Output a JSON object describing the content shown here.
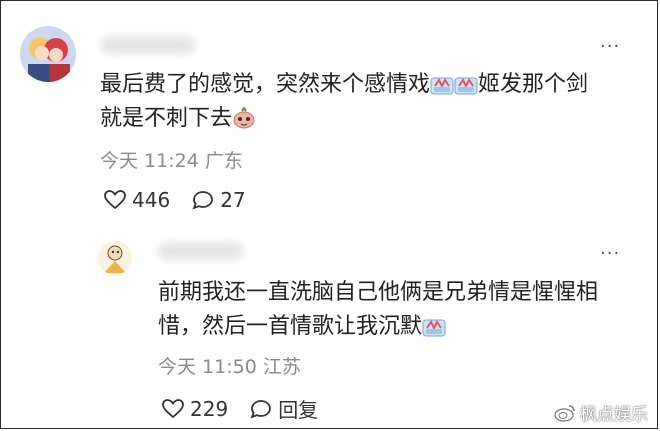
{
  "comment": {
    "text_line1": "最后费了的感觉，突然来个感情戏",
    "text_line1_tail": "姬发那个剑",
    "text_line2": "就是不刺下去",
    "time": "今天 11:24",
    "location": "广东",
    "likes": "446",
    "replies": "27"
  },
  "reply": {
    "text_line1": "前期我还一直洗脑自己他俩是兄弟情是惺惺相",
    "text_line2": "惜，然后一首情歌让我沉默",
    "time": "今天 11:50",
    "location": "江苏",
    "likes": "229",
    "reply_label": "回复"
  },
  "watermark": "枫点娱乐",
  "icons": [
    "more-icon",
    "heart-icon",
    "comment-icon",
    "emoji-icon",
    "weibo-logo-icon"
  ],
  "colors": {
    "text": "#222222",
    "meta": "#8a8a8a",
    "border": "#2b2b2b"
  }
}
